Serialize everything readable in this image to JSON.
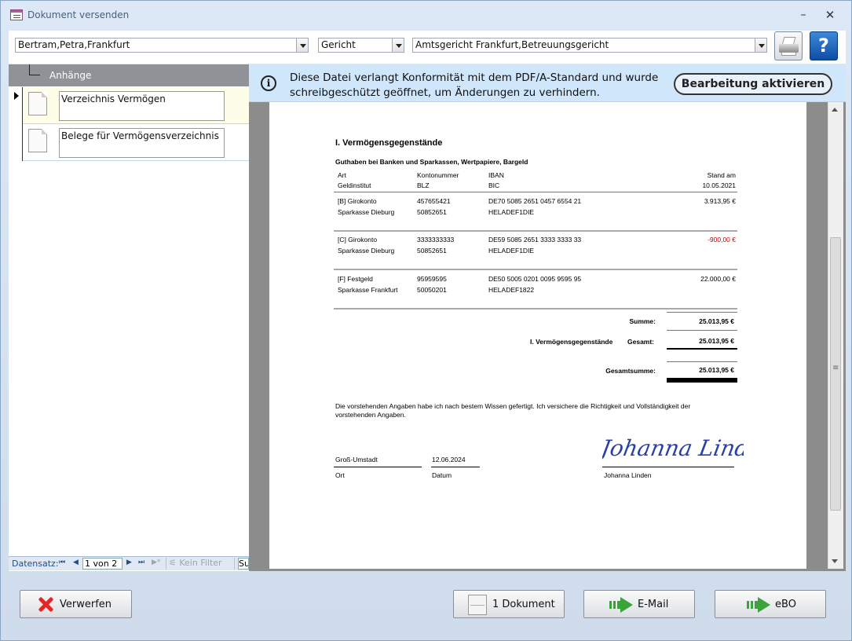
{
  "window": {
    "title": "Dokument versenden",
    "minimize": "–",
    "close": "✕"
  },
  "toolbar": {
    "person": "Bertram,Petra,Frankfurt",
    "type": "Gericht",
    "recipient": "Amtsgericht Frankfurt,Betreuungsgericht",
    "help_label": "?"
  },
  "attachments": {
    "header": "Anhänge",
    "items": [
      {
        "label": "Verzeichnis Vermögen"
      },
      {
        "label": "Belege für Vermögensverzeichnis"
      }
    ]
  },
  "navigation": {
    "record_label": "Datensatz:",
    "position": "1 von 2",
    "filter": "Kein Filter",
    "search": "Su",
    "first": "⏮",
    "prev": "◀",
    "next": "▶",
    "last": "⏭",
    "new": "▶*"
  },
  "infobar": {
    "message": "Diese Datei verlangt Konformität mit dem PDF/A-Standard und wurde schreibgeschützt geöffnet, um Änderungen zu verhindern.",
    "button": "Bearbeitung aktivieren"
  },
  "document": {
    "heading": "I. Vermögensgegenstände",
    "subheading": "Guthaben bei Banken und Sparkassen, Wertpapiere, Bargeld",
    "columns": {
      "art": "Art",
      "geldinstitut": "Geldinstitut",
      "konto": "Kontonummer",
      "blz": "BLZ",
      "iban": "IBAN",
      "bic": "BIC",
      "stand": "Stand am",
      "datum": "10.05.2021"
    },
    "accounts": [
      {
        "art": "[B] Girokonto",
        "bank": "Sparkasse Dieburg",
        "konto": "457655421",
        "blz": "50852651",
        "iban": "DE70 5085 2651 0457 6554 21",
        "bic": "HELADEF1DIE",
        "amount": "3.913,95 €",
        "negative": false
      },
      {
        "art": "[C] Girokonto",
        "bank": "Sparkasse Dieburg",
        "konto": "3333333333",
        "blz": "50852651",
        "iban": "DE59 5085 2651 3333 3333 33",
        "bic": "HELADEF1DIE",
        "amount": "-900,00 €",
        "negative": true
      },
      {
        "art": "[F] Festgeld",
        "bank": "Sparkasse Frankfurt",
        "konto": "95959595",
        "blz": "50050201",
        "iban": "DE50 5005 0201 0095 9595 95",
        "bic": "HELADEF1822",
        "amount": "22.000,00 €",
        "negative": false
      }
    ],
    "summe_label": "Summe:",
    "summe": "25.013,95 €",
    "gesamt_group": "I. Vermögensgegenstände",
    "gesamt_label": "Gesamt:",
    "gesamt": "25.013,95 €",
    "gesamtsumme_label": "Gesamtsumme:",
    "gesamtsumme": "25.013,95 €",
    "declaration": "Die vorstehenden Angaben habe ich nach bestem Wissen gefertigt. Ich versichere die Richtigkeit und Vollständigkeit der",
    "declaration2": "vorstehenden Angaben.",
    "place": "Groß-Umstadt",
    "date": "12.06.2024",
    "place_label": "Ort",
    "date_label": "Datum",
    "signature_name": "Johanna Linden",
    "signature_text": "Johanna Linden"
  },
  "buttons": {
    "discard": "Verwerfen",
    "documents": "1 Dokument",
    "email": "E-Mail",
    "ebo": "eBO"
  }
}
